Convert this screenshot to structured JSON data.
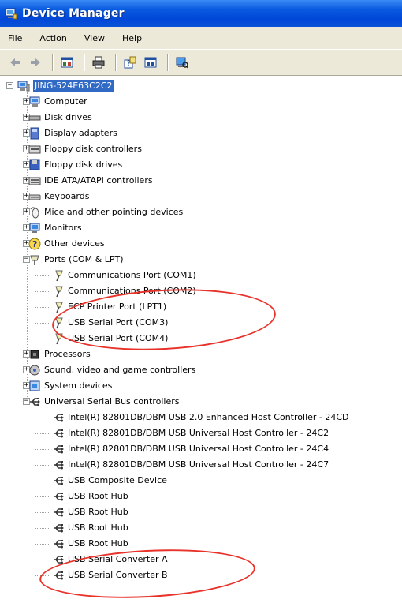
{
  "window": {
    "title": "Device Manager"
  },
  "menu": [
    "File",
    "Action",
    "View",
    "Help"
  ],
  "toolbar": {
    "icons": [
      "back-icon",
      "forward-icon",
      "properties-icon",
      "print-icon",
      "help-icon",
      "view-icon",
      "scan-hardware-icon"
    ]
  },
  "tree": {
    "root": "JING-524E63C2C2",
    "categories": [
      {
        "label": "Computer",
        "icon": "computer-icon",
        "expanded": false
      },
      {
        "label": "Disk drives",
        "icon": "disk-drive-icon",
        "expanded": false
      },
      {
        "label": "Display adapters",
        "icon": "display-adapter-icon",
        "expanded": false
      },
      {
        "label": "Floppy disk controllers",
        "icon": "floppy-controller-icon",
        "expanded": false
      },
      {
        "label": "Floppy disk drives",
        "icon": "floppy-drive-icon",
        "expanded": false
      },
      {
        "label": "IDE ATA/ATAPI controllers",
        "icon": "ide-controller-icon",
        "expanded": false
      },
      {
        "label": "Keyboards",
        "icon": "keyboard-icon",
        "expanded": false
      },
      {
        "label": "Mice and other pointing devices",
        "icon": "mouse-icon",
        "expanded": false
      },
      {
        "label": "Monitors",
        "icon": "monitor-icon",
        "expanded": false
      },
      {
        "label": "Other devices",
        "icon": "unknown-device-icon",
        "expanded": false
      },
      {
        "label": "Ports (COM & LPT)",
        "icon": "port-icon",
        "expanded": true,
        "children": [
          "Communications Port (COM1)",
          "Communications Port (COM2)",
          "ECP Printer Port (LPT1)",
          "USB Serial Port (COM3)",
          "USB Serial Port (COM4)"
        ]
      },
      {
        "label": "Processors",
        "icon": "processor-icon",
        "expanded": false
      },
      {
        "label": "Sound, video and game controllers",
        "icon": "sound-icon",
        "expanded": false
      },
      {
        "label": "System devices",
        "icon": "system-device-icon",
        "expanded": false
      },
      {
        "label": "Universal Serial Bus controllers",
        "icon": "usb-icon",
        "expanded": true,
        "children": [
          "Intel(R) 82801DB/DBM USB 2.0 Enhanced Host Controller - 24CD",
          "Intel(R) 82801DB/DBM USB Universal Host Controller - 24C2",
          "Intel(R) 82801DB/DBM USB Universal Host Controller - 24C4",
          "Intel(R) 82801DB/DBM USB Universal Host Controller - 24C7",
          "USB Composite Device",
          "USB Root Hub",
          "USB Root Hub",
          "USB Root Hub",
          "USB Root Hub",
          "USB Serial Converter A",
          "USB Serial Converter B"
        ]
      }
    ]
  },
  "colors": {
    "titlebar": "#0a52d8",
    "selection": "#316ac5",
    "annotation": "#e8322a"
  }
}
